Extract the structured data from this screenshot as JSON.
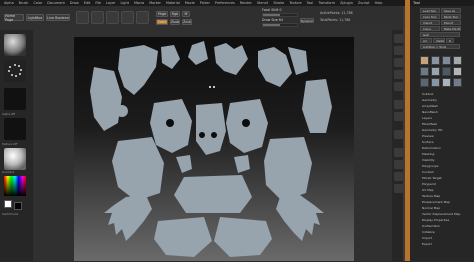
{
  "menu": [
    "Alpha",
    "Brush",
    "Color",
    "Document",
    "Draw",
    "Edit",
    "File",
    "Layer",
    "Light",
    "Macro",
    "Marker",
    "Material",
    "Movie",
    "Picker",
    "Preferences",
    "Render",
    "Stencil",
    "Stroke",
    "Texture",
    "Tool",
    "Transform",
    "Zplugin",
    "Zscript",
    "Help"
  ],
  "top_buttons": {
    "home_page": "Home Page",
    "lightbox": "LightBox",
    "live_boolean": "Live Boolean"
  },
  "mode_buttons": [
    "Edit",
    "Draw",
    "Move",
    "Scale",
    "Rotate"
  ],
  "toggles": {
    "mrgb": "Mrgb",
    "rgb": "Rgb",
    "m": "M",
    "zadd": "Zadd",
    "zsub": "Zsub",
    "zcut": "Zcut"
  },
  "sliders": {
    "focal_shift": {
      "label": "Focal Shift 0",
      "value": 0.0
    },
    "z_intensity": {
      "label": "Z Intensity 25",
      "value": 0.25
    },
    "draw_size": {
      "label": "Draw Size 64",
      "value": 0.5
    },
    "dynamic": "Dynamic"
  },
  "stats": {
    "active_points": "ActivePoints: 11,786",
    "total_points": "TotalPoints: 11,786"
  },
  "left_shelf": {
    "alpha_label": "Alpha Off",
    "texture_label": "Texture Off",
    "material_label": "",
    "gradient": "Gradient",
    "switch_color": "SwitchColor",
    "alternate": "Alternate"
  },
  "colors": {
    "accent": "#b8742c",
    "uv_shell": "#97a3ad",
    "background_top": "#0e0e0e",
    "background_bottom": "#6a6a6a"
  },
  "tool_panel": {
    "title": "Tool",
    "buttons": [
      "Load Tool",
      "Save As",
      "Copy Tool",
      "Paste Tool",
      "Import",
      "Export",
      "Clone",
      "Make PolyMesh3D",
      "GoZ",
      "All",
      "Visible",
      "R",
      "Lightbox > Tools"
    ],
    "subpalettes": [
      "Subtool",
      "Geometry",
      "ArrayMesh",
      "NanoMesh",
      "Layers",
      "FiberMesh",
      "Geometry HD",
      "Preview",
      "Surface",
      "Deformation",
      "Masking",
      "Visibility",
      "Polygroups",
      "Contact",
      "Morph Target",
      "Polypaint",
      "UV Map",
      "Texture Map",
      "Displacement Map",
      "Normal Map",
      "Vector Displacement Map",
      "Display Properties",
      "Unified Skin",
      "Initialize",
      "Import",
      "Export"
    ]
  },
  "status_bar": {
    "left": "",
    "right": "Morph UV"
  }
}
